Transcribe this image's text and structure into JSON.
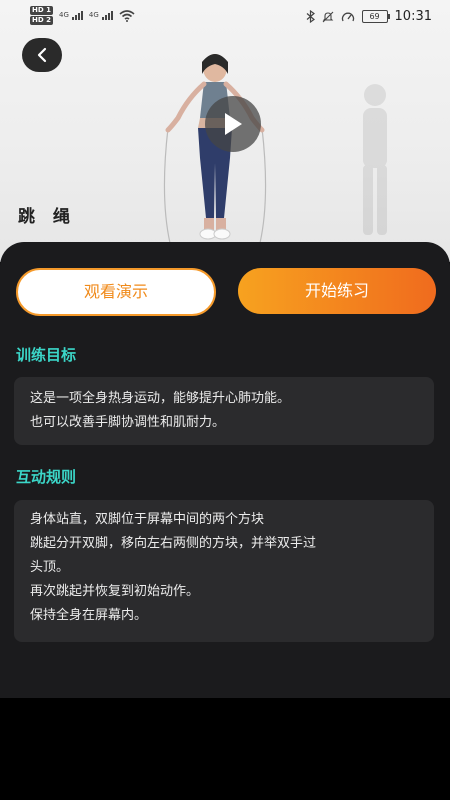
{
  "status_bar": {
    "hd1": "HD 1",
    "hd2": "HD 2",
    "network1": "4G",
    "network2": "4G",
    "battery": "69",
    "time": "10:31"
  },
  "hero": {
    "title": "跳 绳",
    "icons": {
      "back": "back-arrow-icon",
      "play": "play-icon"
    }
  },
  "actions": {
    "demo_label": "观看演示",
    "start_label": "开始练习"
  },
  "colors": {
    "accent_orange": "#f59a2b",
    "accent_teal": "#3bd6c8",
    "panel_bg": "#1b1b1d",
    "card_bg": "#2b2b2d"
  },
  "training_goal": {
    "heading": "训练目标",
    "lines": [
      "这是一项全身热身运动，能够提升心肺功能。",
      "也可以改善手脚协调性和肌耐力。"
    ]
  },
  "interaction_rules": {
    "heading": "互动规则",
    "lines": [
      "身体站直，双脚位于屏幕中间的两个方块",
      "跳起分开双脚，移向左右两侧的方块，并举双手过",
      "头顶。",
      "再次跳起并恢复到初始动作。",
      "保持全身在屏幕内。"
    ]
  }
}
